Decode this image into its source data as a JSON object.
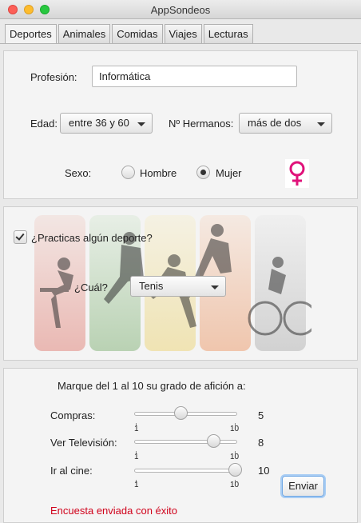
{
  "window": {
    "title": "AppSondeos"
  },
  "tabs": [
    {
      "label": "Deportes",
      "active": true
    },
    {
      "label": "Animales",
      "active": false
    },
    {
      "label": "Comidas",
      "active": false
    },
    {
      "label": "Viajes",
      "active": false
    },
    {
      "label": "Lecturas",
      "active": false
    }
  ],
  "personal": {
    "profesion_label": "Profesión:",
    "profesion_value": "Informática",
    "edad_label": "Edad:",
    "edad_value": "entre 36 y 60",
    "hermanos_label": "Nº Hermanos:",
    "hermanos_value": "más de dos",
    "sexo_label": "Sexo:",
    "sexo_options": [
      {
        "label": "Hombre",
        "selected": false
      },
      {
        "label": "Mujer",
        "selected": true
      }
    ],
    "gender_icon": "female-symbol-icon",
    "gender_color": "#e0127a"
  },
  "deporte": {
    "practica_label": "¿Practicas algún deporte?",
    "practica_checked": true,
    "cual_label": "¿Cuál?",
    "cual_value": "Tenis",
    "card_colors": [
      "#d9584a",
      "#5a9a4a",
      "#e8c84a",
      "#e87a3a",
      "#9a9a9a"
    ]
  },
  "aficion": {
    "heading": "Marque del 1 al 10 su grado de afición a:",
    "items": [
      {
        "label": "Compras:",
        "value": 5,
        "min": 1,
        "max": 10,
        "min_label": "1",
        "max_label": "10",
        "value_label": "5"
      },
      {
        "label": "Ver Televisión:",
        "value": 8,
        "min": 1,
        "max": 10,
        "min_label": "1",
        "max_label": "10",
        "value_label": "8"
      },
      {
        "label": "Ir al cine:",
        "value": 10,
        "min": 1,
        "max": 10,
        "min_label": "1",
        "max_label": "10",
        "value_label": "10"
      }
    ],
    "submit_label": "Enviar",
    "status_text": "Encuesta enviada con éxito",
    "status_color": "#d0021b"
  }
}
